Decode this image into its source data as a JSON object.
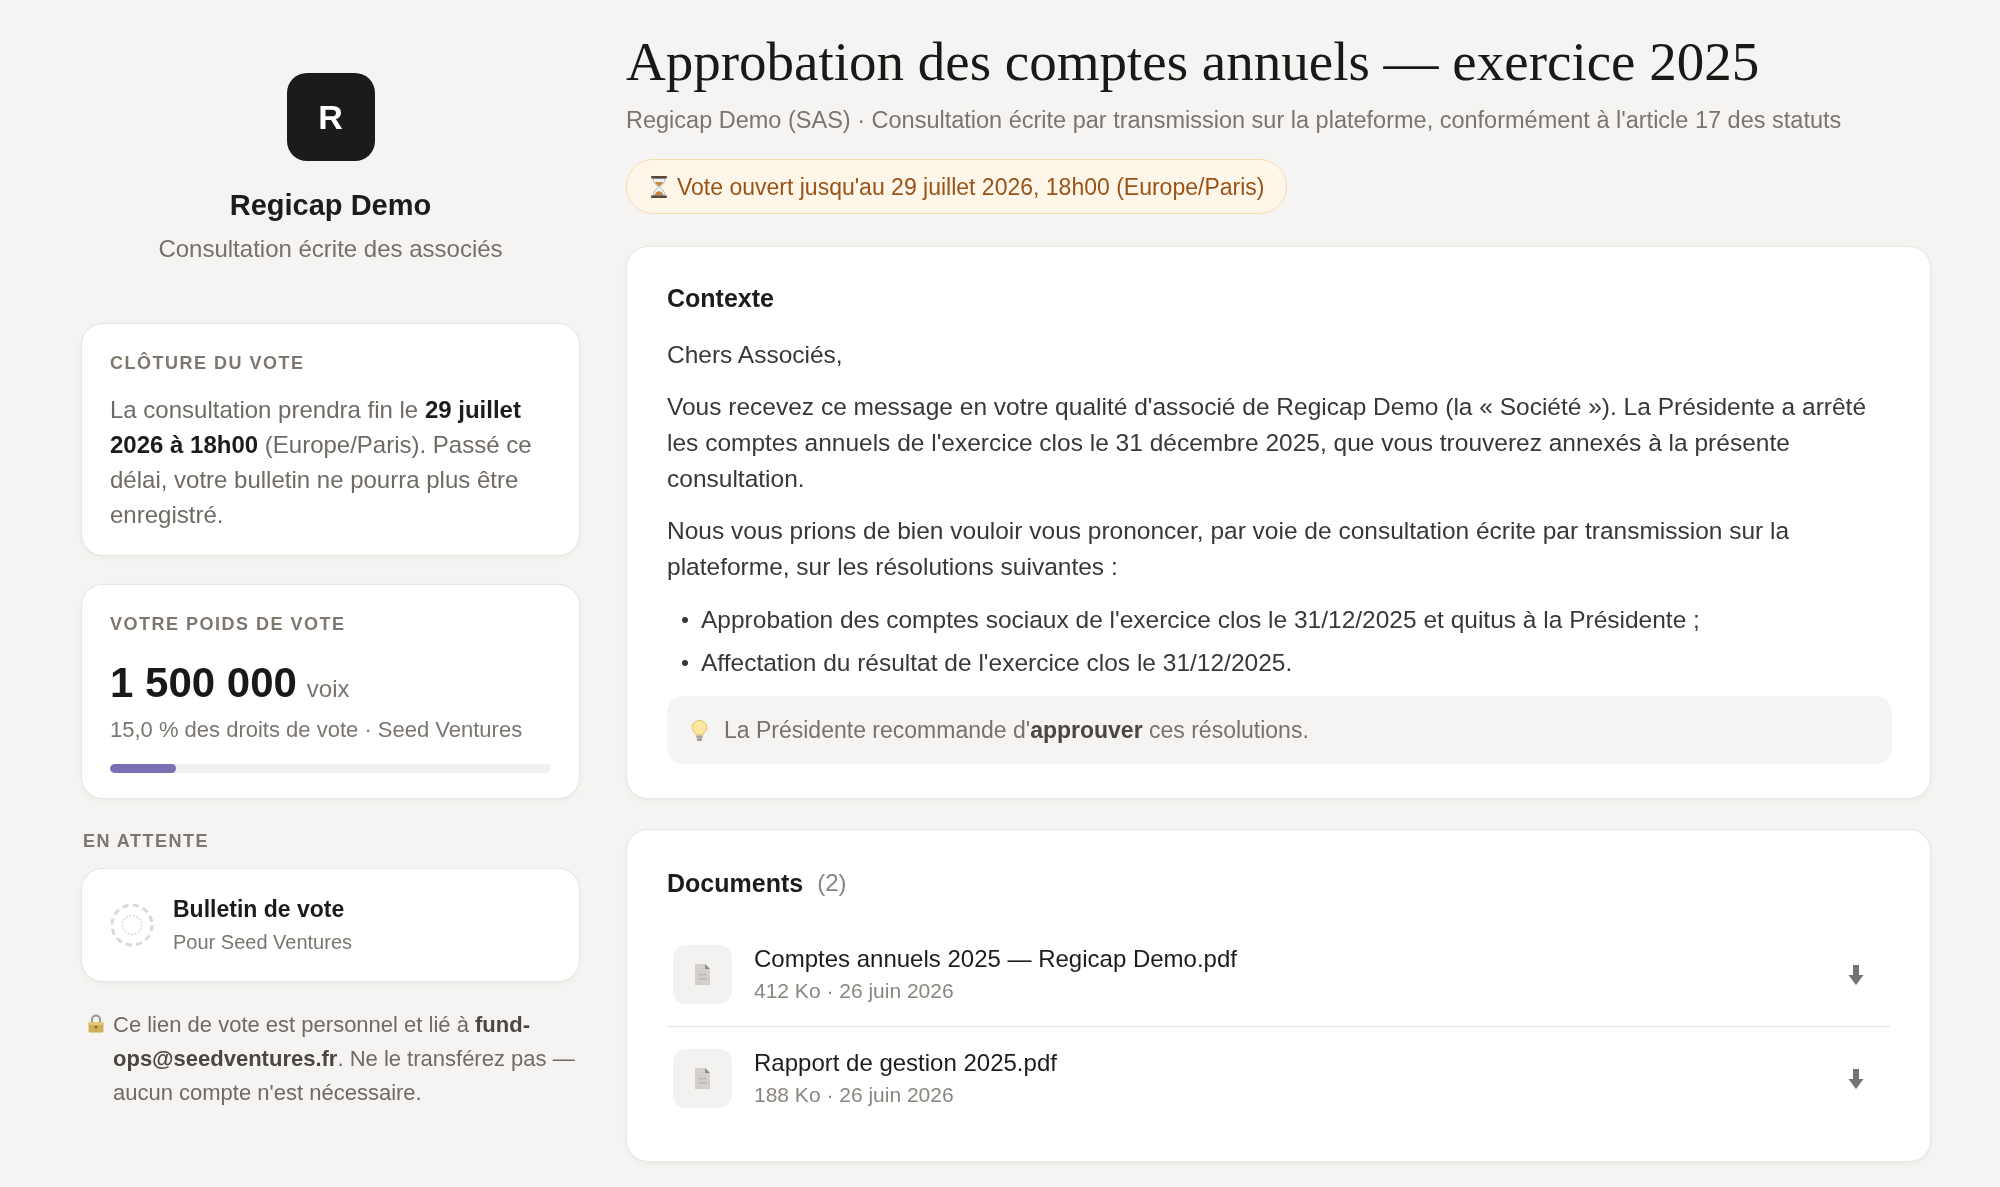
{
  "sidebar": {
    "logo_letter": "R",
    "organization": "Regicap Demo",
    "subtitle": "Consultation écrite des associés",
    "deadline_card": {
      "label": "CLÔTURE DU VOTE",
      "text": "La consultation prendra fin le **29 juillet 2026 à 18h00** (Europe/Paris). Passé ce délai, votre bulletin ne pourra plus être enregistré."
    },
    "weight_card": {
      "label": "VOTRE POIDS DE VOTE",
      "votes": "1 500 000",
      "unit": "voix",
      "detail": "15,0 % des droits de vote · Seed Ventures",
      "level": 0.15
    },
    "status_label": "EN ATTENTE",
    "ballot": {
      "title": "Bulletin de vote",
      "subtitle": "Pour Seed Ventures"
    },
    "notice": "Ce lien de vote est personnel et lié à **fund-ops@seedventures.fr**. Ne le transférez pas — aucun compte n'est nécessaire."
  },
  "header": {
    "title": "Approbation des comptes annuels — exercice 2025",
    "subtitle": "Regicap Demo (SAS) · Consultation écrite par transmission sur la plateforme, conformément à l'article 17 des statuts",
    "deadline": "Vote ouvert jusqu'au 29 juillet 2026, 18h00 (Europe/Paris)"
  },
  "context": {
    "heading": "Contexte",
    "paragraphs": [
      "Chers Associés,",
      "Vous recevez ce message en votre qualité d'associé de Regicap Demo (la « Société »). La Présidente a arrêté les comptes annuels de l'exercice clos le 31 décembre 2025, que vous trouverez annexés à la présente consultation.",
      "Nous vous prions de bien vouloir vous prononcer, par voie de consultation écrite par transmission sur la plateforme, sur les résolutions suivantes :"
    ],
    "resolutions": [
      "Approbation des comptes sociaux de l'exercice clos le 31/12/2025 et quitus à la Présidente ;",
      "Affectation du résultat de l'exercice clos le 31/12/2025."
    ],
    "recommendation": "La Présidente recommande d'**approuver** ces résolutions."
  },
  "documents": {
    "heading": "Documents",
    "count": "(2)",
    "files": [
      {
        "name": "Comptes annuels 2025 — Regicap Demo.pdf",
        "meta": "412 Ko · 26 juin 2026"
      },
      {
        "name": "Rapport de gestion 2025.pdf",
        "meta": "188 Ko · 26 juin 2026"
      }
    ]
  }
}
